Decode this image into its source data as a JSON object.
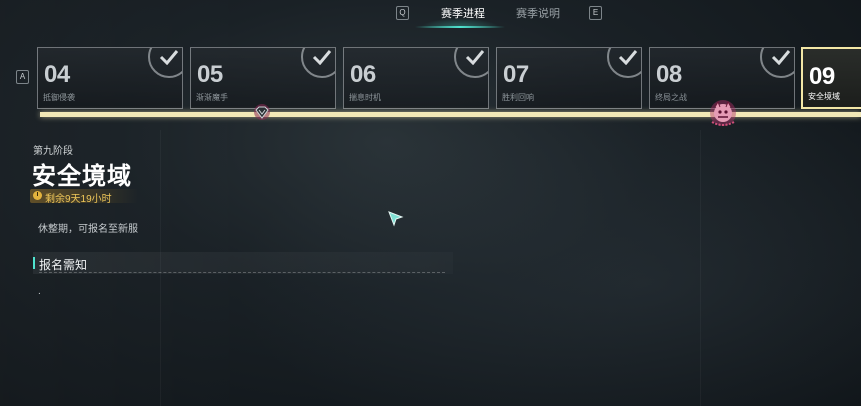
{
  "topnav": {
    "key_left": "Q",
    "key_right": "E",
    "tabs": [
      {
        "label": "赛季进程",
        "active": true
      },
      {
        "label": "赛季说明",
        "active": false
      }
    ],
    "accent": "#4fe3cf"
  },
  "strip": {
    "key_prev": "A",
    "stages": [
      {
        "num": "04",
        "label": "抵御侵袭",
        "completed": true
      },
      {
        "num": "05",
        "label": "渐渐魔手",
        "completed": true
      },
      {
        "num": "06",
        "label": "揣息时机",
        "completed": true
      },
      {
        "num": "07",
        "label": "胜利回响",
        "completed": true
      },
      {
        "num": "08",
        "label": "终局之战",
        "completed": true
      },
      {
        "num": "09",
        "label": "安全境域",
        "completed": false,
        "current": true
      }
    ],
    "progress_color": "#f2e8b6"
  },
  "info": {
    "stage_sub": "第九阶段",
    "stage_title": "安全境域",
    "remaining": "剩余9天19小时",
    "description": "休整期，可报名至新服",
    "section_title": "报名需知",
    "section_body": "."
  }
}
